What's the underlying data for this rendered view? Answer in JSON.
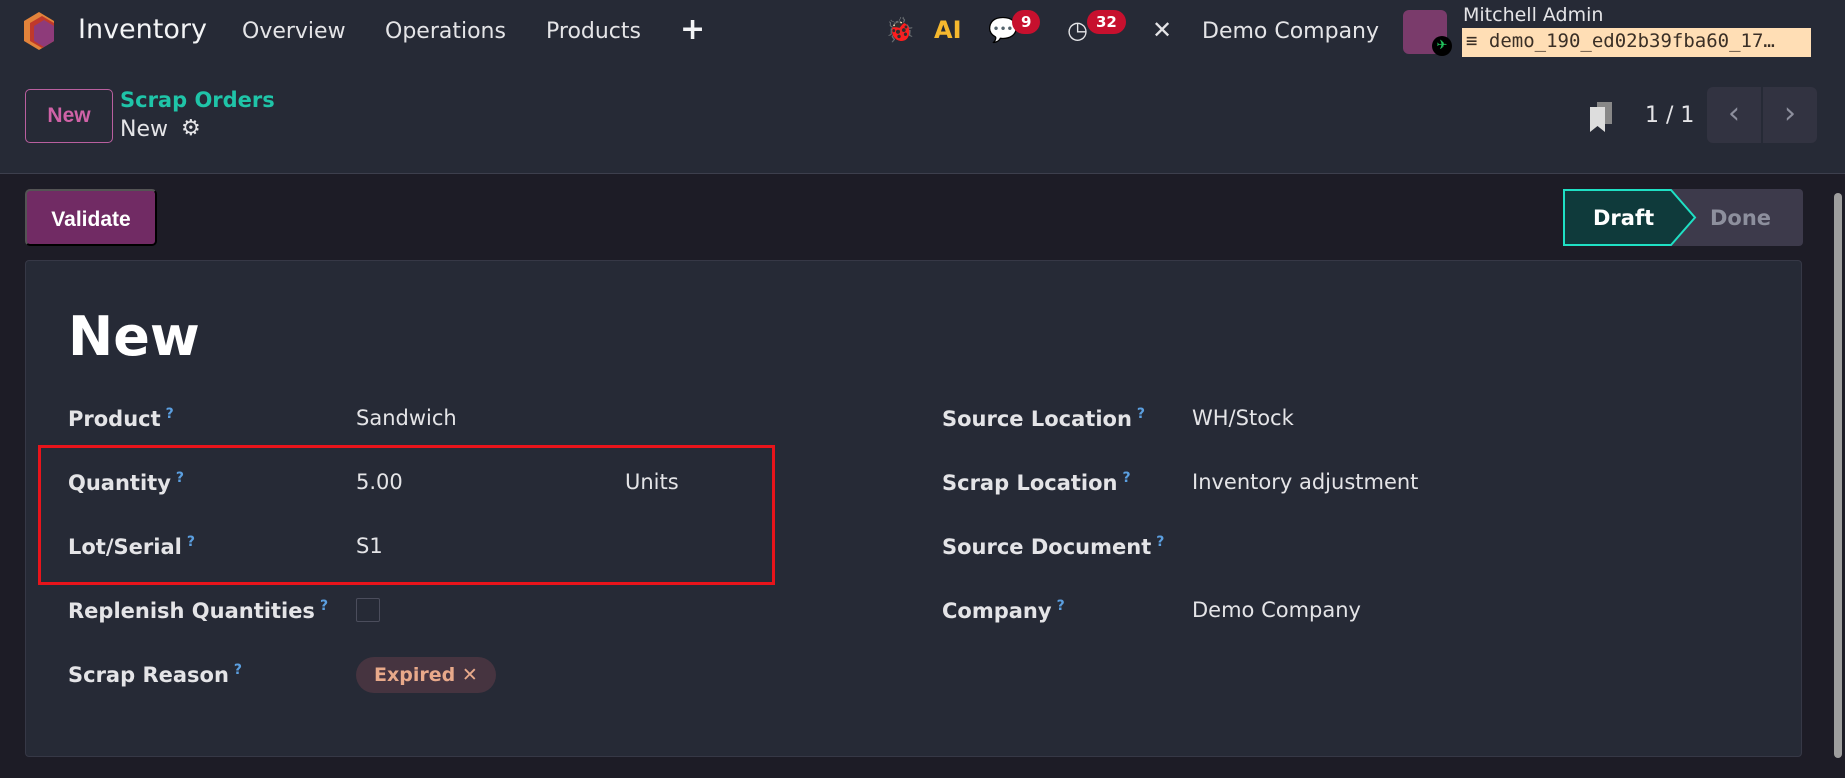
{
  "topbar": {
    "app": "Inventory",
    "menu": [
      "Overview",
      "Operations",
      "Products"
    ],
    "messages_count": "9",
    "activities_count": "32",
    "company": "Demo Company",
    "user": "Mitchell Admin",
    "database": "demo_190_ed02b39fba60_17…"
  },
  "control_panel": {
    "new_label": "New",
    "breadcrumb_parent": "Scrap Orders",
    "breadcrumb_current": "New",
    "pager": "1 / 1"
  },
  "actions": {
    "validate": "Validate"
  },
  "statusbar": {
    "steps": [
      "Draft",
      "Done"
    ],
    "active": "Draft"
  },
  "form": {
    "title": "New",
    "left": [
      {
        "label": "Product",
        "value": "Sandwich"
      },
      {
        "label": "Quantity",
        "value": "5.00",
        "unit": "Units"
      },
      {
        "label": "Lot/Serial",
        "value": "S1"
      },
      {
        "label": "Replenish Quantities",
        "checked": false
      },
      {
        "label": "Scrap Reason",
        "tag": "Expired"
      }
    ],
    "right": [
      {
        "label": "Source Location",
        "value": "WH/Stock"
      },
      {
        "label": "Scrap Location",
        "value": "Inventory adjustment"
      },
      {
        "label": "Source Document",
        "value": ""
      },
      {
        "label": "Company",
        "value": "Demo Company"
      }
    ],
    "help": "?"
  },
  "colors": {
    "accent": "#712b64",
    "teal": "#1fc4a8",
    "highlight": "#e8141b"
  }
}
